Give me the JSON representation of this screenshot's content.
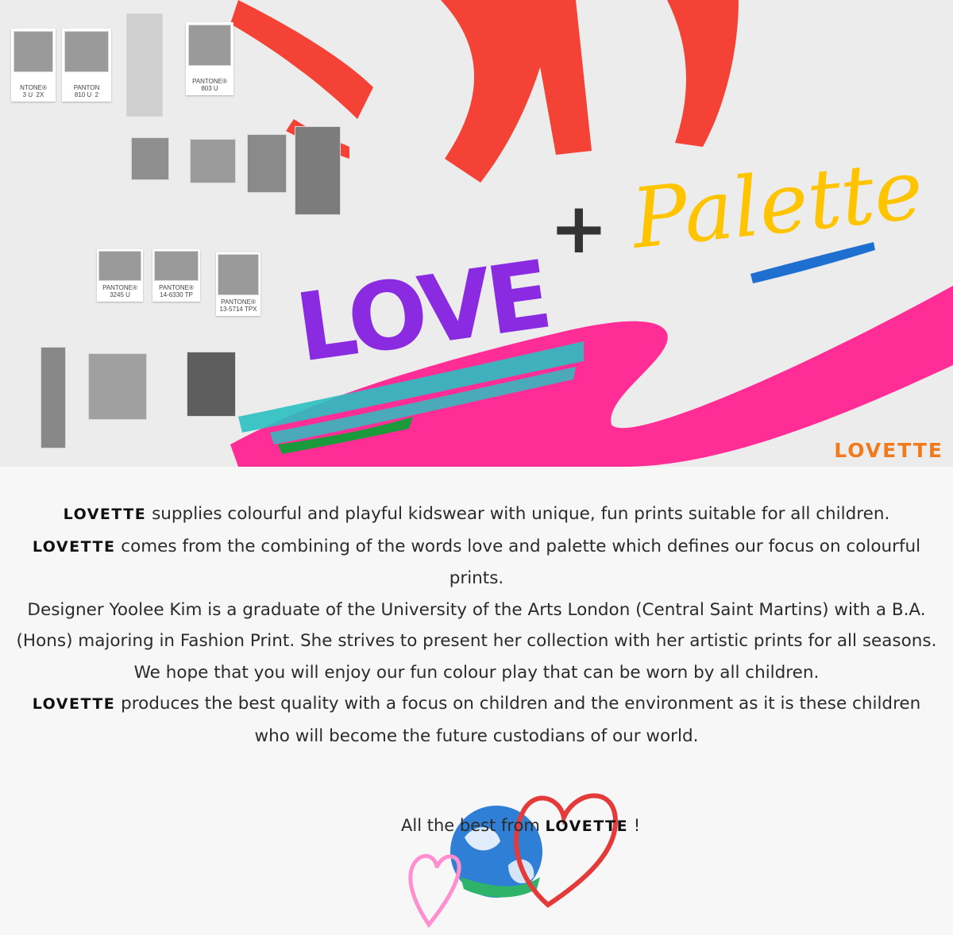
{
  "hero": {
    "headline_love": "LOVE",
    "headline_plus": "+",
    "headline_palette": "Palette",
    "brand_corner": "LOVETTE",
    "swatches": [
      {
        "label": "NTONE®\n3 U  2X"
      },
      {
        "label": "PANTON\n810 U  2"
      },
      {
        "label": "PANTONE®\n803 U"
      },
      {
        "label": "PANTONE®\n3245 U"
      },
      {
        "label": "PANTONE®\n14-6330 TP"
      },
      {
        "label": "PANTONE®\n13-5714 TPX"
      }
    ]
  },
  "colors": {
    "brand_orange": "#f07a1c",
    "red_stroke": "#f44336",
    "pink_stroke": "#ff2d95",
    "teal_stroke": "#2bc0c0",
    "purple_text": "#8a2be2",
    "yellow_text": "#ffc400",
    "blue_underline": "#1f6fd1"
  },
  "body": {
    "brand": "LOVETTE",
    "line1_rest": " supplies colourful and playful kidswear with unique, fun prints suitable for all children.",
    "line2_rest": " comes from the combining of the words love and palette which defines our focus on colourful prints.",
    "line3": "Designer Yoolee Kim is a graduate of the University of the Arts London (Central Saint Martins) with a B.A. (Hons) majoring in Fashion Print.  She strives to present her collection with her artistic prints for all seasons.",
    "line4": "We hope that you will enjoy our fun colour play that can be worn by all children.",
    "line5_rest": "  produces the best quality with a focus on children and the environment as it is these children who will become the future custodians of our world."
  },
  "signoff": {
    "prefix": "All the best from ",
    "brand": "LOVETTE",
    "suffix": " !"
  }
}
